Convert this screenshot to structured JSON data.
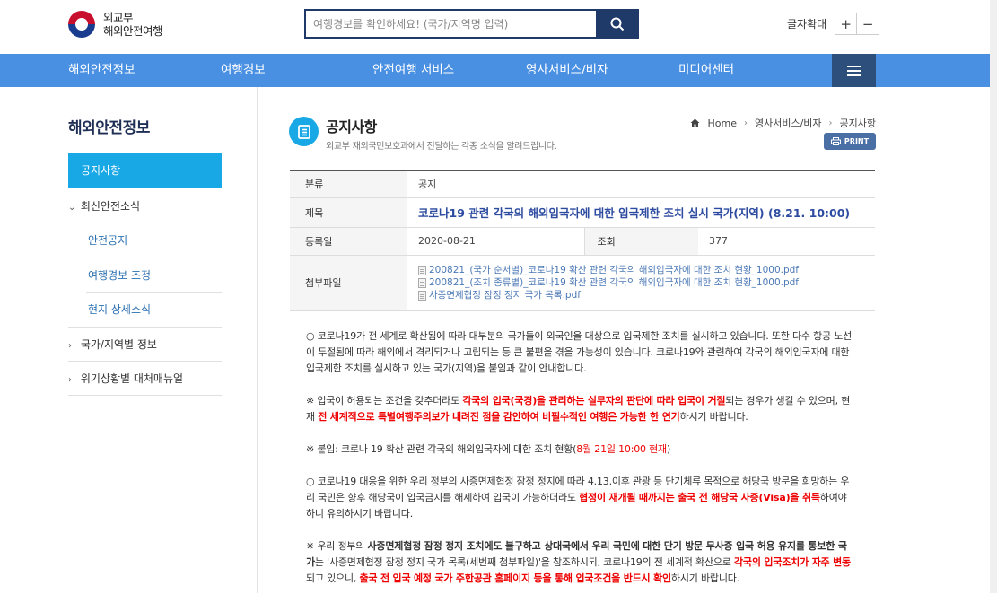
{
  "header": {
    "logo_line1": "외교부",
    "logo_line2": "해외안전여행",
    "search_placeholder": "여행경보를 확인하세요! (국가/지역명 입력)",
    "font_size_label": "글자확대",
    "font_plus": "+",
    "font_minus": "−"
  },
  "gnb": [
    "해외안전정보",
    "여행경보",
    "안전여행 서비스",
    "영사서비스/비자",
    "미디어센터"
  ],
  "sidebar": {
    "title": "해외안전정보",
    "active": "공지사항",
    "sec1": "최신안전소식",
    "sub": [
      "안전공지",
      "여행경보 조정",
      "현지 상세소식"
    ],
    "sec2": "국가/지역별 정보",
    "sec3": "위기상황별 대처매뉴얼"
  },
  "page": {
    "title": "공지사항",
    "desc": "외교부 재외국민보호과에서 전달하는 각종 소식을 알려드립니다.",
    "breadcrumb": [
      "Home",
      "영사서비스/비자",
      "공지사항"
    ],
    "print": "PRINT"
  },
  "table": {
    "cat_label": "분류",
    "cat_value": "공지",
    "title_label": "제목",
    "title_value": "코로나19 관련 각국의 해외입국자에 대한 입국제한 조치 실시 국가(지역) (8.21. 10:00)",
    "date_label": "등록일",
    "date_value": "2020-08-21",
    "views_label": "조회",
    "views_value": "377",
    "files_label": "첨부파일",
    "files": [
      "200821_(국가 순서별)_코로나19 확산 관련 각국의 해외입국자에 대한 조치 현황_1000.pdf",
      "200821_(조치 종류별)_코로나19 확산 관련 각국의 해외입국자에 대한 조치 현황_1000.pdf",
      "사증면제협정 잠정 정지 국가 목록.pdf"
    ]
  },
  "body": {
    "p1": "○ 코로나19가 전 세계로 확산됨에 따라 대부분의 국가들이 외국인을 대상으로 입국제한 조치를 실시하고 있습니다. 또한 다수 항공 노선이 두절됨에 따라 해외에서 격리되거나 고립되는 등 큰 불편을 겪을 가능성이 있습니다. 코로나19와 관련하여 각국의 해외입국자에 대한 입국제한 조치를 실시하고 있는 국가(지역)을 붙임과 같이 안내합니다.",
    "p2a": "※ 입국이 허용되는 조건을 갖추더라도 ",
    "p2b": "각국의 입국(국경)을 관리하는 실무자의 판단에 따라 입국이 거절",
    "p2c": "되는 경우가 생길 수 있으며, 현재 ",
    "p2d": "전 세계적으로 특별여행주의보가 내려진 점을 감안하여 비필수적인 여행은 가능한 한 연기",
    "p2e": "하시기 바랍니다.",
    "p3a": "※ 붙임: 코로나 19 확산 관련 각국의 해외입국자에 대한 조치 현황(",
    "p3b": "8월 21일 10:00 현재",
    "p3c": ")",
    "p4a": "○ 코로나19 대응을 위한 우리 정부의 사증면제협정 잠정 정지에 따라 4.13.이후 관광 등 단기체류 목적으로 해당국 방문을 희망하는 우리 국민은 향후 해당국이 입국금지를 해제하여 입국이 가능하더라도 ",
    "p4b": "협정이 재개될 때까지는 출국 전 해당국 사증(Visa)을 취득",
    "p4c": "하여야 하니 유의하시기 바랍니다.",
    "p5a": "※ 우리 정부의 ",
    "p5b": "사증면제협정 잠정 정지 조치에도 불구하고 상대국에서 우리 국민에 대한 단기 방문 무사증 입국 허용 유지를 통보한 국가",
    "p5c": "는 '사증면제협정 잠정 정지 국가 목록(세번째 첨부파일)'을 참조하시되, 코로나19의 전 세계적 확산으로 ",
    "p5d": "각국의 입국조치가 자주 변동",
    "p5e": "되고 있으니, ",
    "p5f": "출국 전 입국 예정 국가 주한공관 홈페이지 등을 통해 입국조건을 반드시 확인",
    "p5g": "하시기 바랍니다."
  }
}
